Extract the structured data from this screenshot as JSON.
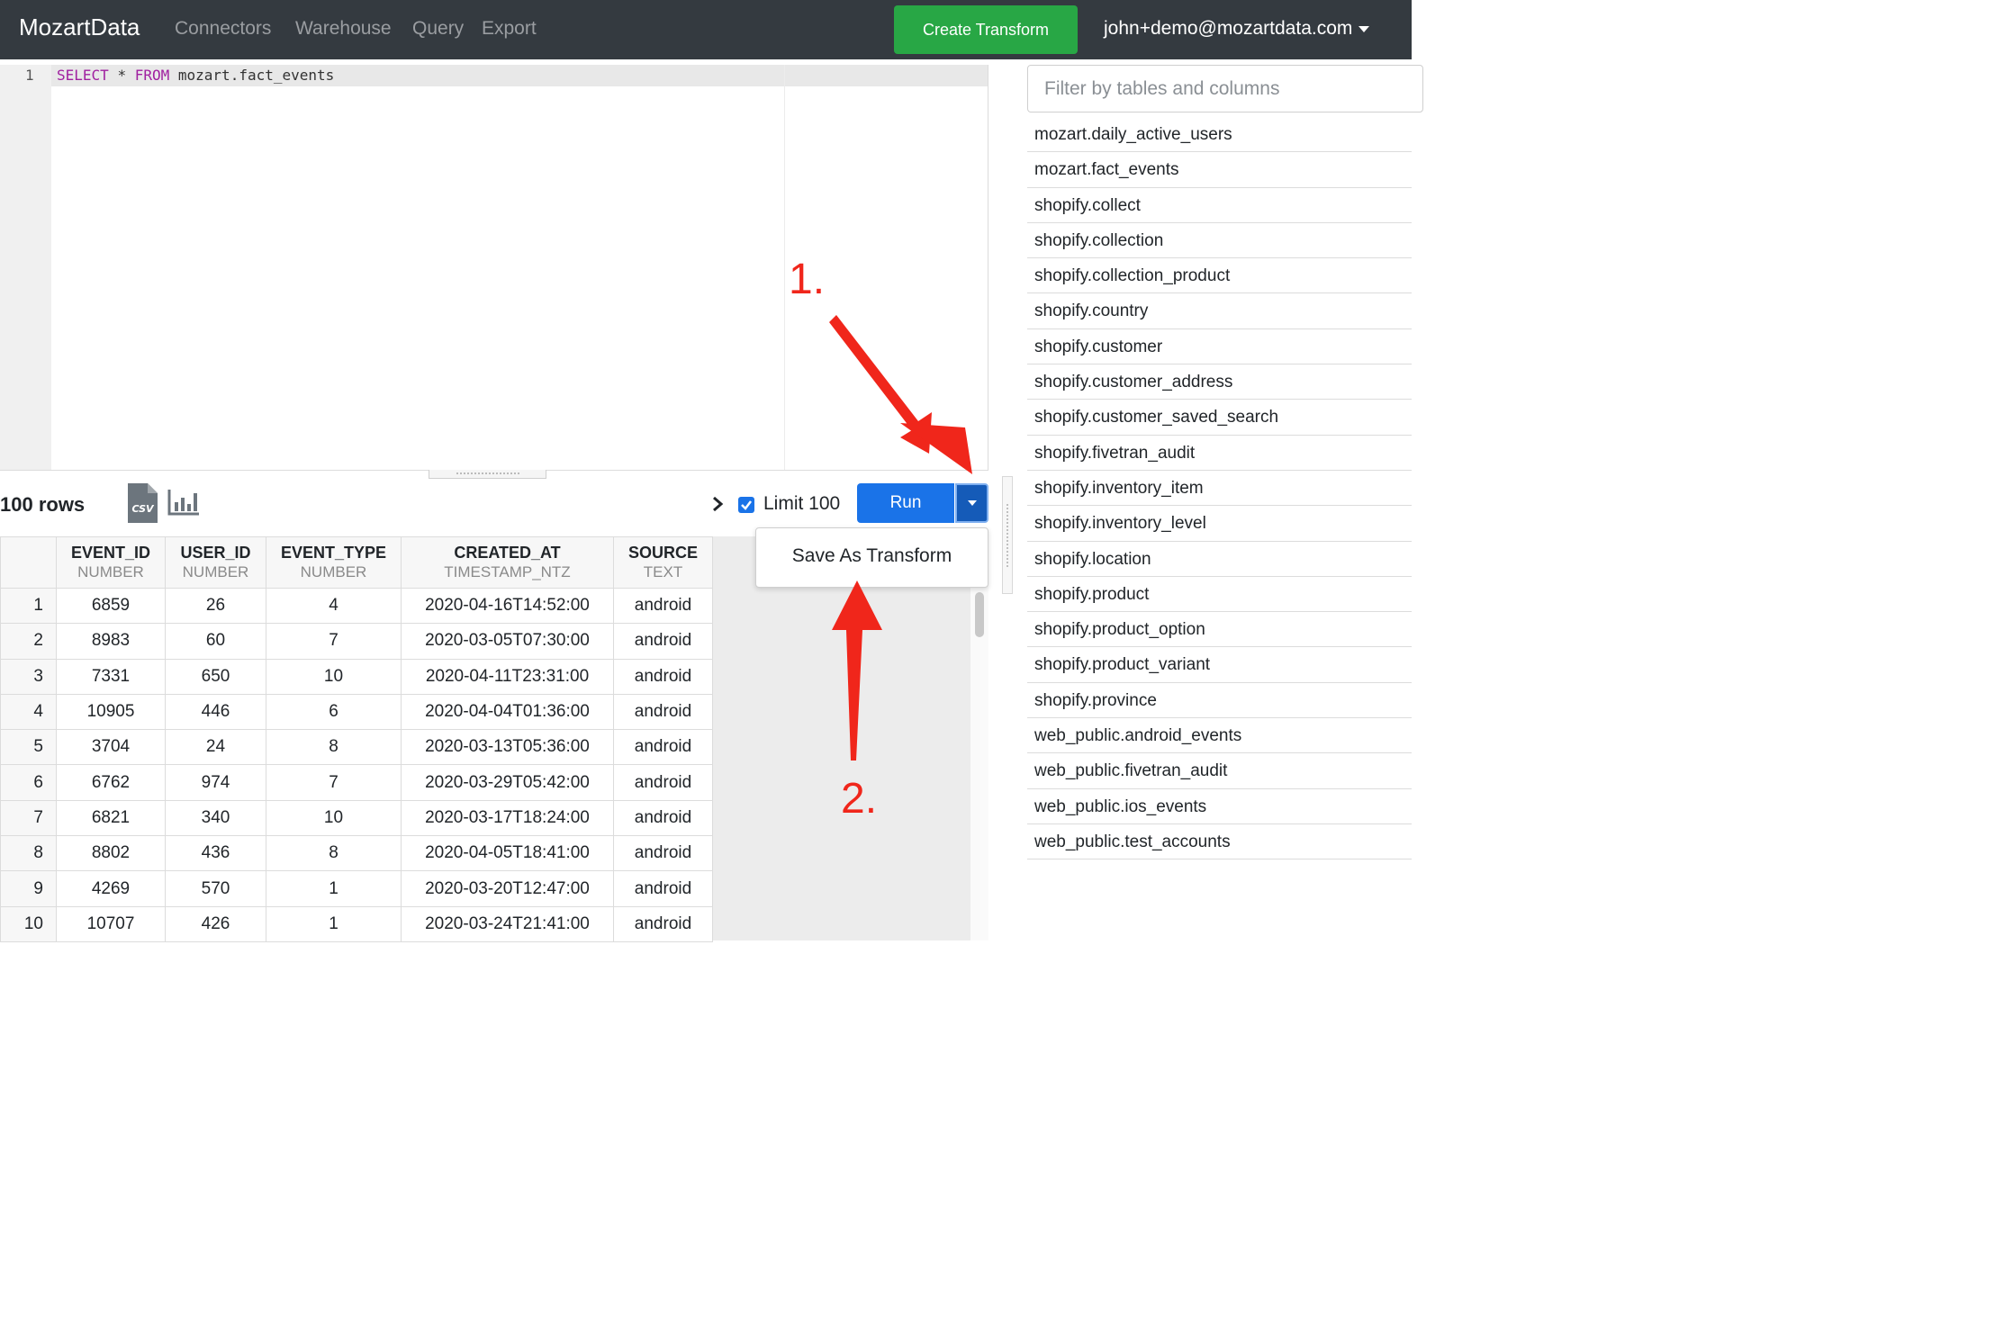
{
  "nav": {
    "brand": "MozartData",
    "links": [
      "Connectors",
      "Warehouse",
      "Query",
      "Export"
    ],
    "create_button": "Create Transform",
    "user": "john+demo@mozartdata.com"
  },
  "editor": {
    "line_number": "1",
    "keyword_select": "SELECT",
    "star": "*",
    "keyword_from": "FROM",
    "table": "mozart.fact_events"
  },
  "toolbar": {
    "rows_label": "100 rows",
    "csv_icon": "csv-file-icon",
    "chart_icon": "bar-chart-icon",
    "limit_label": "Limit 100",
    "limit_checked": true,
    "run_label": "Run"
  },
  "dropdown": {
    "save_as_transform": "Save As Transform"
  },
  "results": {
    "columns": [
      {
        "name": "EVENT_ID",
        "type": "NUMBER"
      },
      {
        "name": "USER_ID",
        "type": "NUMBER"
      },
      {
        "name": "EVENT_TYPE",
        "type": "NUMBER"
      },
      {
        "name": "CREATED_AT",
        "type": "TIMESTAMP_NTZ"
      },
      {
        "name": "SOURCE",
        "type": "TEXT"
      }
    ],
    "rows": [
      {
        "idx": "1",
        "cells": [
          "6859",
          "26",
          "4",
          "2020-04-16T14:52:00",
          "android"
        ]
      },
      {
        "idx": "2",
        "cells": [
          "8983",
          "60",
          "7",
          "2020-03-05T07:30:00",
          "android"
        ]
      },
      {
        "idx": "3",
        "cells": [
          "7331",
          "650",
          "10",
          "2020-04-11T23:31:00",
          "android"
        ]
      },
      {
        "idx": "4",
        "cells": [
          "10905",
          "446",
          "6",
          "2020-04-04T01:36:00",
          "android"
        ]
      },
      {
        "idx": "5",
        "cells": [
          "3704",
          "24",
          "8",
          "2020-03-13T05:36:00",
          "android"
        ]
      },
      {
        "idx": "6",
        "cells": [
          "6762",
          "974",
          "7",
          "2020-03-29T05:42:00",
          "android"
        ]
      },
      {
        "idx": "7",
        "cells": [
          "6821",
          "340",
          "10",
          "2020-03-17T18:24:00",
          "android"
        ]
      },
      {
        "idx": "8",
        "cells": [
          "8802",
          "436",
          "8",
          "2020-04-05T18:41:00",
          "android"
        ]
      },
      {
        "idx": "9",
        "cells": [
          "4269",
          "570",
          "1",
          "2020-03-20T12:47:00",
          "android"
        ]
      },
      {
        "idx": "10",
        "cells": [
          "10707",
          "426",
          "1",
          "2020-03-24T21:41:00",
          "android"
        ]
      }
    ]
  },
  "sidebar": {
    "filter_placeholder": "Filter by tables and columns",
    "tables": [
      "mozart.daily_active_users",
      "mozart.fact_events",
      "shopify.collect",
      "shopify.collection",
      "shopify.collection_product",
      "shopify.country",
      "shopify.customer",
      "shopify.customer_address",
      "shopify.customer_saved_search",
      "shopify.fivetran_audit",
      "shopify.inventory_item",
      "shopify.inventory_level",
      "shopify.location",
      "shopify.product",
      "shopify.product_option",
      "shopify.product_variant",
      "shopify.province",
      "web_public.android_events",
      "web_public.fivetran_audit",
      "web_public.ios_events",
      "web_public.test_accounts"
    ]
  },
  "annotations": {
    "step1": "1.",
    "step2": "2.",
    "color": "#f0261b"
  },
  "colors": {
    "navbar": "#343a40",
    "create_button": "#28a745",
    "run_button": "#1a73e8"
  }
}
